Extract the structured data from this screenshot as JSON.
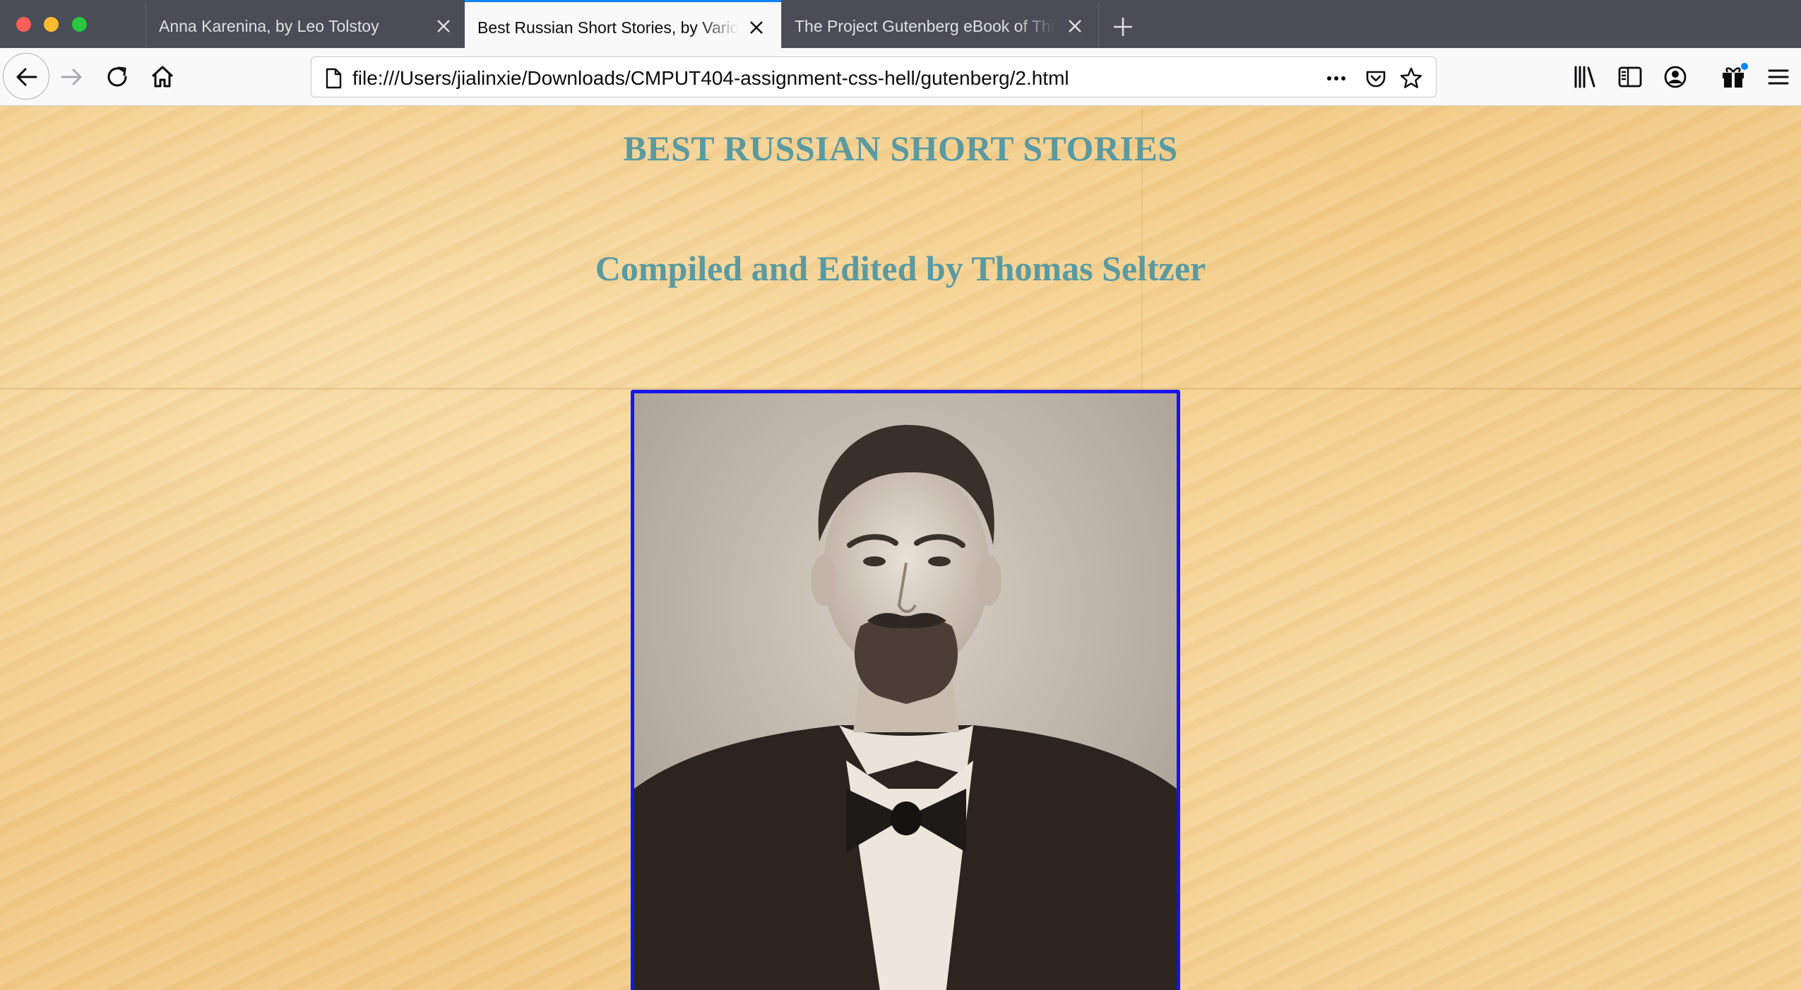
{
  "browser": {
    "tabs": [
      {
        "title": "Anna Karenina, by Leo Tolstoy",
        "active": false
      },
      {
        "title": "Best Russian Short Stories, by Various",
        "active": true
      },
      {
        "title": "The Project Gutenberg eBook of The Brothers Karamazov",
        "active": false
      }
    ],
    "url": "file:///Users/jialinxie/Downloads/CMPUT404-assignment-css-hell/gutenberg/2.html",
    "accent_color": "#0a84ff"
  },
  "page": {
    "heading": "BEST RUSSIAN SHORT STORIES",
    "subheading": "Compiled and Edited by Thomas Seltzer",
    "heading_color": "#5a9aa0",
    "image_border_color": "#1414ee"
  }
}
